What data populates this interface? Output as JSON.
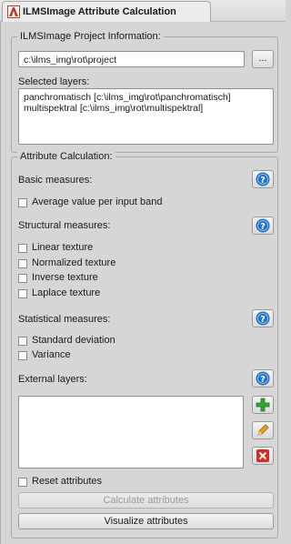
{
  "window": {
    "title": "ILMSImage Attribute Calculation"
  },
  "project": {
    "legend": "ILMSImage Project Information:",
    "path": "c:\\ilms_img\\rot\\project",
    "browse_label": "...",
    "selected_layers_label": "Selected layers:",
    "layers": [
      "panchromatisch [c:\\ilms_img\\rot\\panchromatisch]",
      "multispektral [c:\\ilms_img\\rot\\multispektral]"
    ]
  },
  "attributes": {
    "legend": "Attribute Calculation:",
    "basic": {
      "label": "Basic measures:",
      "items": [
        "Average value per input band"
      ]
    },
    "structural": {
      "label": "Structural measures:",
      "items": [
        "Linear texture",
        "Normalized texture",
        "Inverse texture",
        "Laplace texture"
      ]
    },
    "statistical": {
      "label": "Statistical measures:",
      "items": [
        "Standard deviation",
        "Variance"
      ]
    },
    "external": {
      "label": "External layers:"
    },
    "reset_label": "Reset attributes",
    "calculate_label": "Calculate attributes",
    "visualize_label": "Visualize attributes"
  },
  "colors": {
    "help": "#1f6fc5",
    "add": "#36a336",
    "remove": "#d32a2a",
    "edit": "#e8a21a"
  }
}
